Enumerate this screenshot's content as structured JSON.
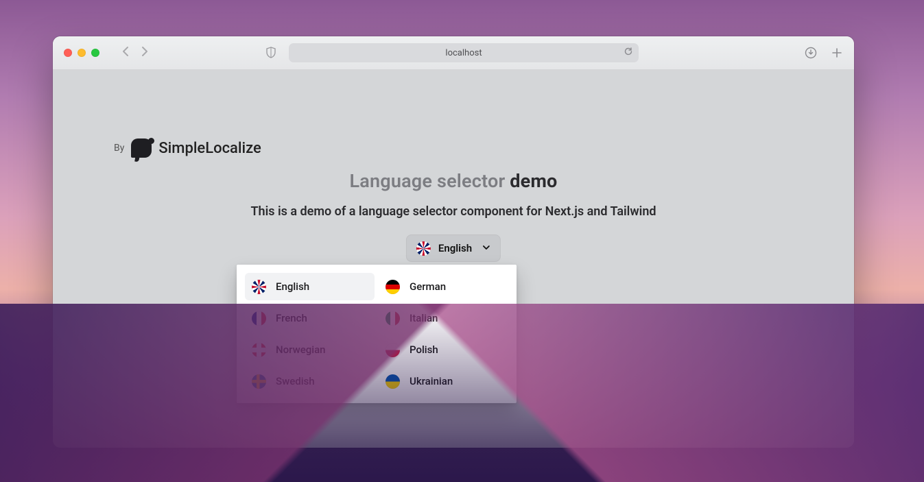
{
  "browser": {
    "url_display": "localhost"
  },
  "brand": {
    "prefix": "By",
    "name": "SimpleLocalize"
  },
  "page": {
    "heading_light": "Language selector ",
    "heading_bold": "demo",
    "subtitle": "This is a demo of a language selector component for Next.js and Tailwind"
  },
  "selector": {
    "current_label": "English",
    "current_flag": "uk",
    "open": true,
    "options": [
      {
        "label": "English",
        "flag": "uk",
        "selected": true
      },
      {
        "label": "German",
        "flag": "de",
        "selected": false
      },
      {
        "label": "French",
        "flag": "fr",
        "selected": false
      },
      {
        "label": "Italian",
        "flag": "it",
        "selected": false
      },
      {
        "label": "Norwegian",
        "flag": "no",
        "selected": false
      },
      {
        "label": "Polish",
        "flag": "pl",
        "selected": false
      },
      {
        "label": "Swedish",
        "flag": "se",
        "selected": false
      },
      {
        "label": "Ukrainian",
        "flag": "ua",
        "selected": false
      }
    ]
  }
}
